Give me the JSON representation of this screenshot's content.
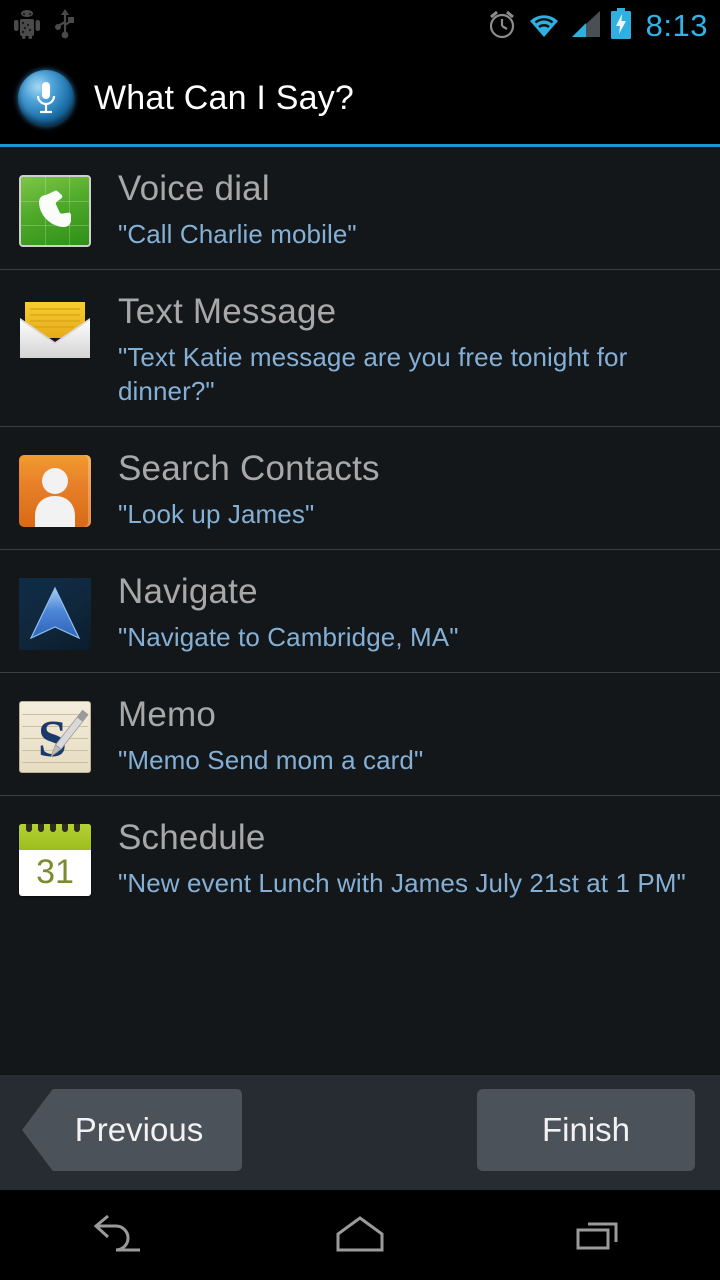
{
  "statusbar": {
    "left_icons": [
      {
        "name": "android-debug-icon"
      },
      {
        "name": "usb-icon"
      }
    ],
    "right_icons": [
      {
        "name": "alarm-clock-icon"
      },
      {
        "name": "wifi-icon"
      },
      {
        "name": "cell-signal-icon"
      },
      {
        "name": "battery-charging-icon"
      }
    ],
    "clock": "8:13",
    "clock_color": "#32b3e8"
  },
  "titlebar": {
    "icon": "microphone-icon",
    "title": "What Can I Say?",
    "accent_color": "#2196c8"
  },
  "list": {
    "items": [
      {
        "icon": "phone-icon",
        "title": "Voice dial",
        "example": "\"Call Charlie mobile\""
      },
      {
        "icon": "envelope-icon",
        "title": "Text Message",
        "example": "\"Text Katie message are you free tonight for dinner?\""
      },
      {
        "icon": "contact-person-icon",
        "title": "Search Contacts",
        "example": "\"Look up James\""
      },
      {
        "icon": "navigation-arrow-icon",
        "title": "Navigate",
        "example": "\"Navigate to Cambridge, MA\""
      },
      {
        "icon": "memo-notepad-icon",
        "title": "Memo",
        "example": "\"Memo Send mom a card\""
      },
      {
        "icon": "calendar-icon",
        "title": "Schedule",
        "example": "\"New event Lunch with James July 21st at 1 PM\"",
        "calendar_day": "31"
      }
    ],
    "title_color": "#a8a8a8",
    "example_color": "#85b0d6"
  },
  "buttonbar": {
    "previous_label": "Previous",
    "finish_label": "Finish",
    "button_color": "#4c5259"
  },
  "navbar": {
    "buttons": [
      {
        "name": "back-icon"
      },
      {
        "name": "home-icon"
      },
      {
        "name": "recents-icon"
      }
    ]
  }
}
